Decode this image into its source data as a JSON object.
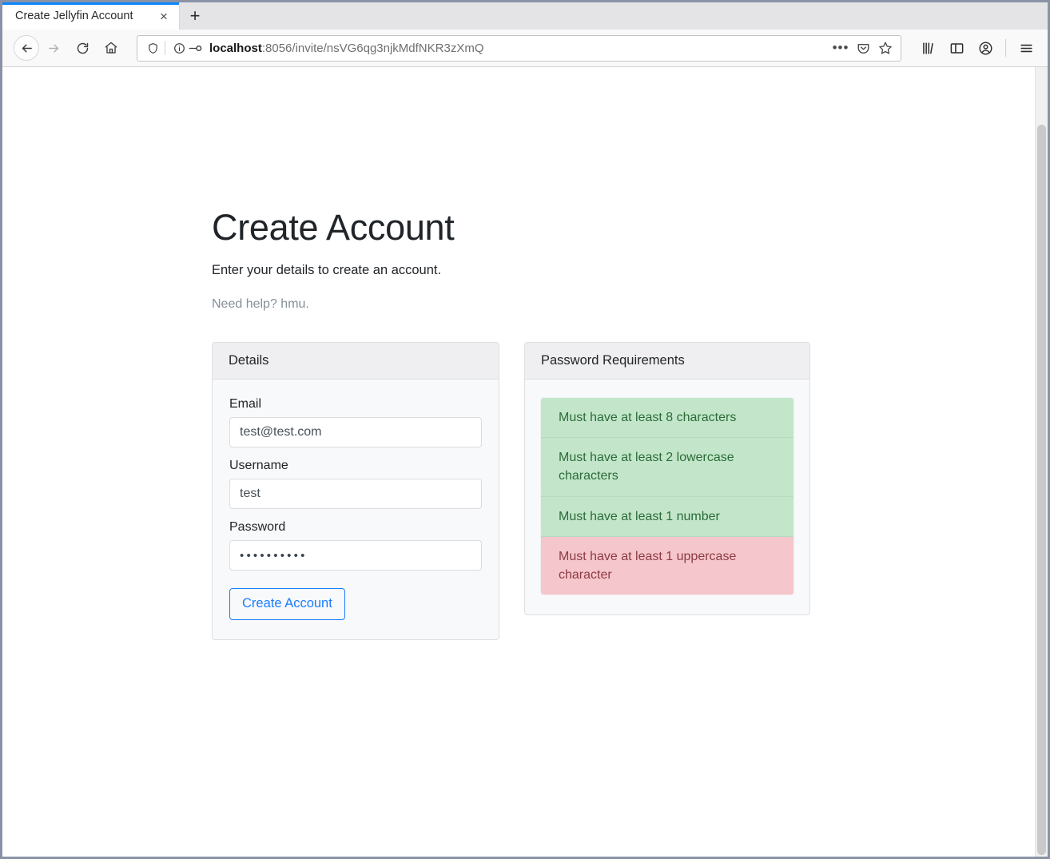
{
  "browser": {
    "tab": {
      "title": "Create Jellyfin Account",
      "close_label": "×"
    },
    "new_tab_label": "+",
    "nav": {
      "back_label": "←",
      "forward_label": "→",
      "reload_label": "⟳",
      "home_label": "⌂"
    },
    "urlbar": {
      "host": "localhost",
      "path": ":8056/invite/nsVG6qg3njkMdfNKR3zXmQ",
      "full_url": "localhost:8056/invite/nsVG6qg3njkMdfNKR3zXmQ",
      "page_actions_label": "•••"
    }
  },
  "page": {
    "title": "Create Account",
    "lead": "Enter your details to create an account.",
    "help": "Need help? hmu."
  },
  "details_card": {
    "header": "Details",
    "fields": [
      {
        "label": "Email",
        "value": "test@test.com",
        "type": "email"
      },
      {
        "label": "Username",
        "value": "test",
        "type": "text"
      },
      {
        "label": "Password",
        "value": "••••••••••",
        "type": "password"
      }
    ],
    "submit_label": "Create Account"
  },
  "requirements_card": {
    "header": "Password Requirements",
    "items": [
      {
        "text": "Must have at least 8 characters",
        "state": "success"
      },
      {
        "text": "Must have at least 2 lowercase characters",
        "state": "success"
      },
      {
        "text": "Must have at least 1 number",
        "state": "success"
      },
      {
        "text": "Must have at least 1 uppercase character",
        "state": "danger"
      }
    ]
  },
  "colors": {
    "accent_blue": "#1a7cff",
    "tab_active_border": "#0a84ff",
    "success_bg": "#c3e6cb",
    "success_text": "#2c6b38",
    "danger_bg": "#f5c6cb",
    "danger_text": "#8c3b43",
    "muted_text": "#868e96",
    "card_header_bg": "#efeff1",
    "card_body_bg": "#f8f9fa"
  }
}
